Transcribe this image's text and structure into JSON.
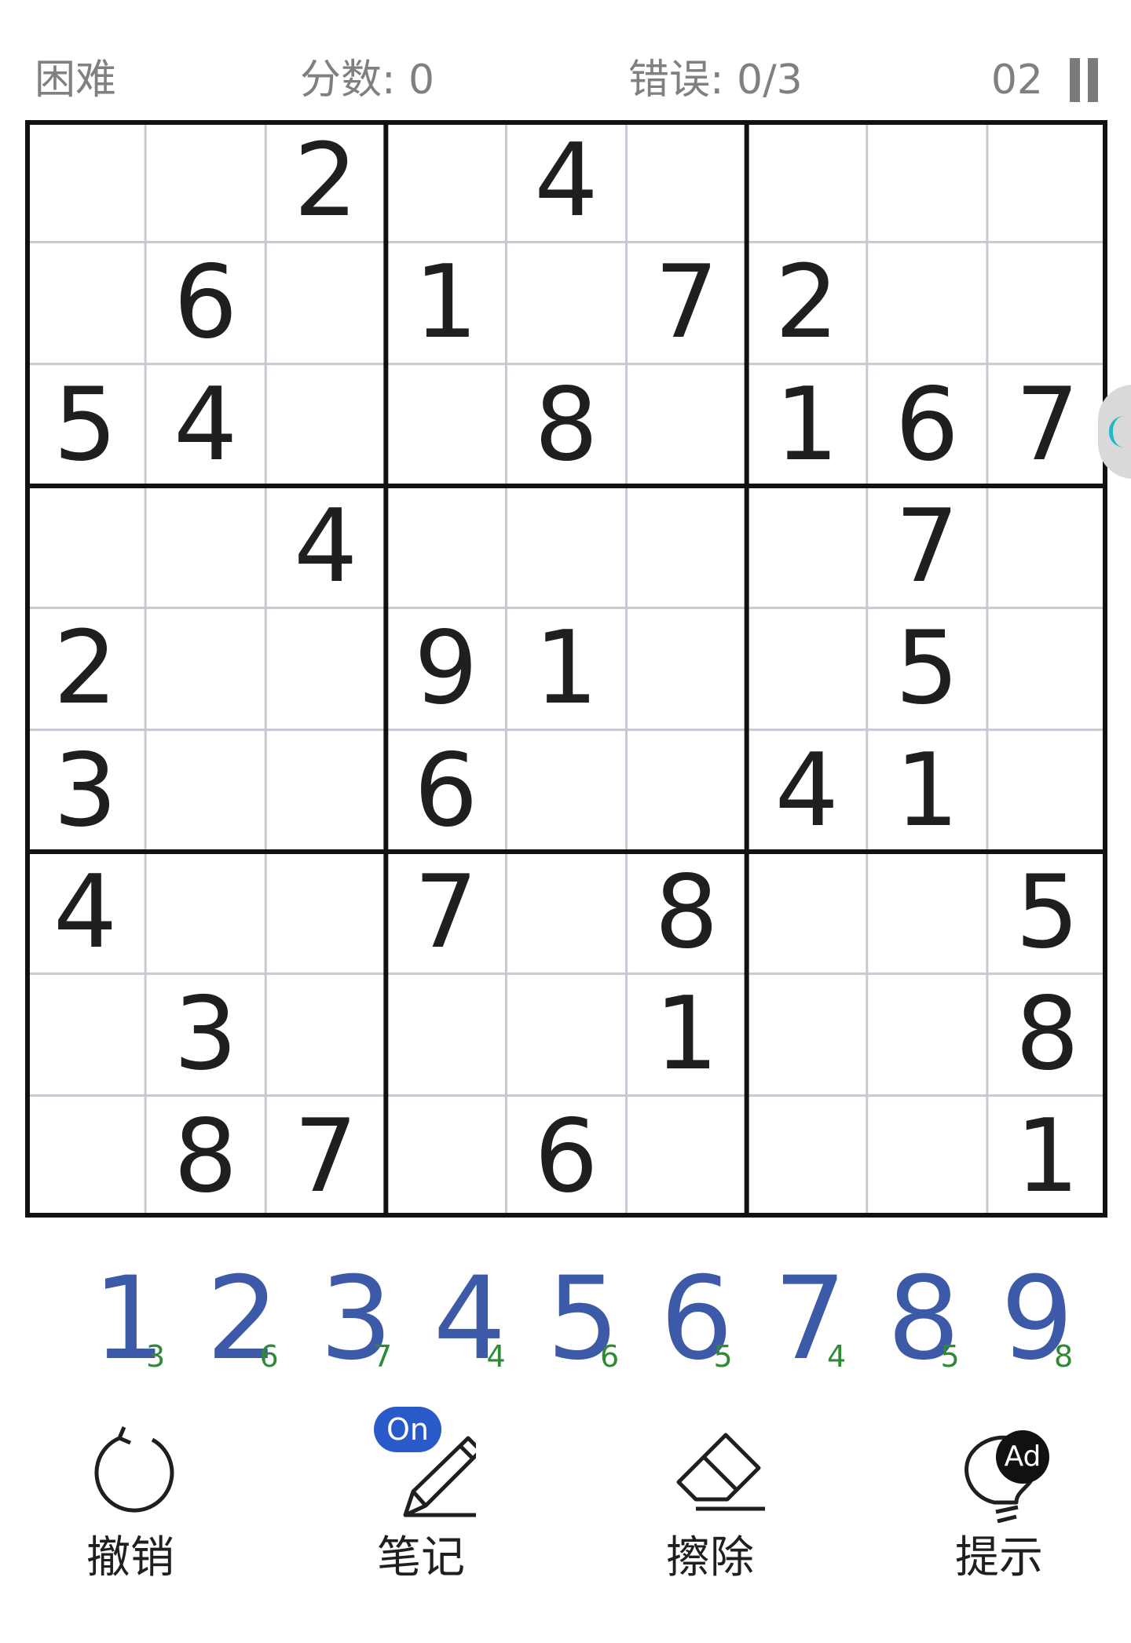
{
  "header": {
    "difficulty": "困难",
    "score": "分数: 0",
    "mistakes": "错误: 0/3",
    "timer": "02"
  },
  "board": {
    "cells": [
      [
        "",
        "",
        "2",
        "",
        "4",
        "",
        "",
        "",
        ""
      ],
      [
        "",
        "6",
        "",
        "1",
        "",
        "7",
        "2",
        "",
        ""
      ],
      [
        "5",
        "4",
        "",
        "",
        "8",
        "",
        "1",
        "6",
        "7"
      ],
      [
        "",
        "",
        "4",
        "",
        "",
        "",
        "",
        "7",
        ""
      ],
      [
        "2",
        "",
        "",
        "9",
        "1",
        "",
        "",
        "5",
        ""
      ],
      [
        "3",
        "",
        "",
        "6",
        "",
        "",
        "4",
        "1",
        ""
      ],
      [
        "4",
        "",
        "",
        "7",
        "",
        "8",
        "",
        "",
        "5"
      ],
      [
        "",
        "3",
        "",
        "",
        "",
        "1",
        "",
        "",
        "8"
      ],
      [
        "",
        "8",
        "7",
        "",
        "6",
        "",
        "",
        "",
        "1"
      ]
    ]
  },
  "numpad": [
    {
      "digit": "1",
      "count": "3"
    },
    {
      "digit": "2",
      "count": "6"
    },
    {
      "digit": "3",
      "count": "7"
    },
    {
      "digit": "4",
      "count": "4"
    },
    {
      "digit": "5",
      "count": "6"
    },
    {
      "digit": "6",
      "count": "5"
    },
    {
      "digit": "7",
      "count": "4"
    },
    {
      "digit": "8",
      "count": "5"
    },
    {
      "digit": "9",
      "count": "8"
    }
  ],
  "toolbar": {
    "undo": {
      "label": "撤销",
      "icon": "undo-icon"
    },
    "notes": {
      "label": "笔记",
      "icon": "pencil-icon",
      "badge": "On"
    },
    "erase": {
      "label": "擦除",
      "icon": "eraser-icon"
    },
    "hint": {
      "label": "提示",
      "icon": "lightbulb-icon",
      "badge": "Ad"
    }
  },
  "colors": {
    "digit_blue": "#3d5aa8",
    "count_green": "#2f8a36",
    "badge_blue": "#2a59c9",
    "header_gray": "#808080",
    "grid_thin": "#c8c8d2",
    "grid_thick": "#111111"
  }
}
